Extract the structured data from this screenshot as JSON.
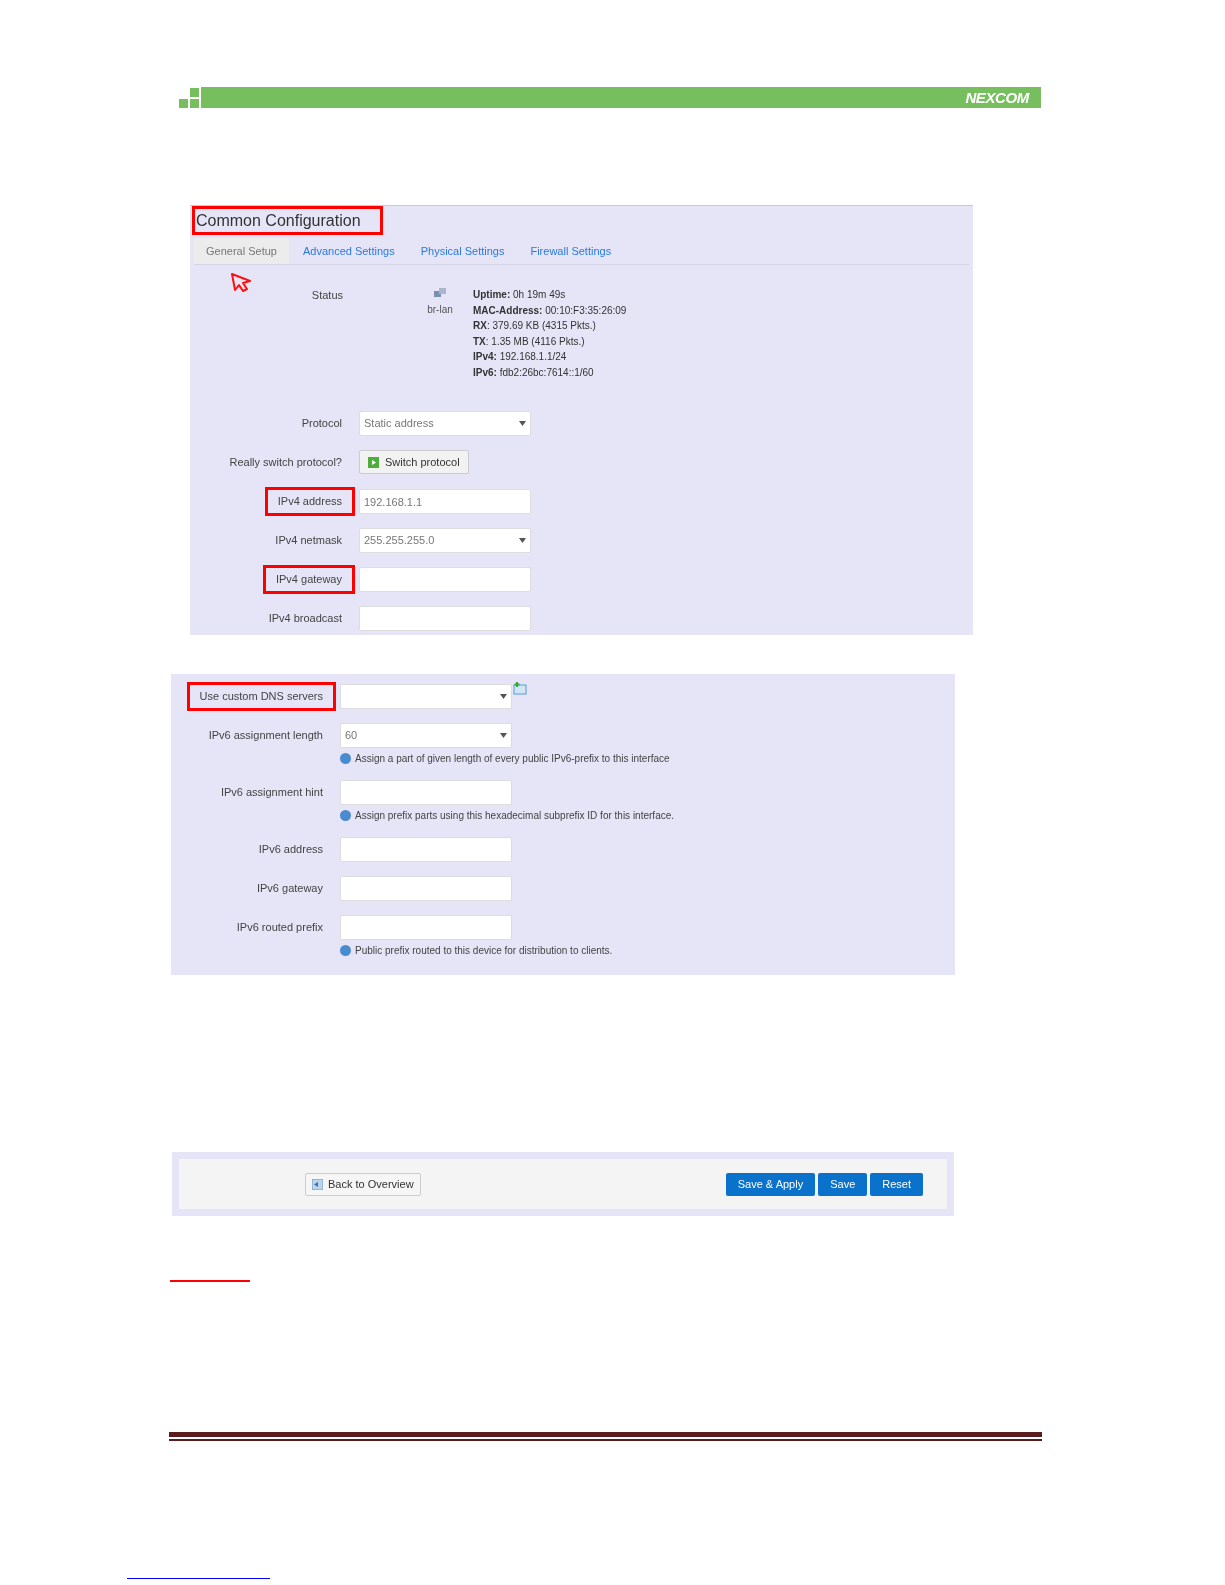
{
  "header": {
    "logo": "NEXCOM"
  },
  "common": {
    "title": "Common Configuration",
    "title_highlighted": true,
    "tabs": [
      {
        "label": "General Setup",
        "selected": true
      },
      {
        "label": "Advanced Settings",
        "selected": false
      },
      {
        "label": "Physical Settings",
        "selected": false
      },
      {
        "label": "Firewall Settings",
        "selected": false
      }
    ],
    "status": {
      "label": "Status",
      "interface": "br-lan",
      "lines": [
        "**Uptime:** 0h 19m 49s",
        "**MAC-Address:** 00:10:F3:35:26:09",
        "**RX**: 379.69 KB (4315 Pkts.)",
        "**TX**: 1.35 MB (4116 Pkts.)",
        "**IPv4:** 192.168.1.1/24",
        "**IPv6:** fdb2:26bc:7614::1/60"
      ]
    },
    "fields": [
      {
        "kind": "select",
        "label": "Protocol",
        "value": "Static address",
        "highlighted": false,
        "add": false
      },
      {
        "kind": "button",
        "label": "Really switch protocol?",
        "button": "Switch protocol",
        "highlighted": false,
        "add": false
      },
      {
        "kind": "text",
        "label": "IPv4 address",
        "value": "192.168.1.1",
        "highlighted": true,
        "add": false
      },
      {
        "kind": "select",
        "label": "IPv4 netmask",
        "value": "255.255.255.0",
        "highlighted": false,
        "add": false
      },
      {
        "kind": "text",
        "label": "IPv4 gateway",
        "highlighted": true,
        "add": false
      },
      {
        "kind": "text",
        "label": "IPv4 broadcast",
        "highlighted": false,
        "add": false
      }
    ]
  },
  "ipv6": {
    "fields": [
      {
        "kind": "select",
        "label": "Use custom DNS servers",
        "highlighted": true,
        "add": true
      },
      {
        "kind": "select",
        "label": "IPv6 assignment length",
        "value": "60",
        "hint": "Assign a part of given length of every public IPv6-prefix to this interface",
        "highlighted": false,
        "add": false
      },
      {
        "kind": "text",
        "label": "IPv6 assignment hint",
        "hint": "Assign prefix parts using this hexadecimal subprefix ID for this interface.",
        "highlighted": false,
        "add": false
      },
      {
        "kind": "text",
        "label": "IPv6 address",
        "highlighted": false,
        "add": false
      },
      {
        "kind": "text",
        "label": "IPv6 gateway",
        "highlighted": false,
        "add": false
      },
      {
        "kind": "text",
        "label": "IPv6 routed prefix",
        "hint": "Public prefix routed to this device for distribution to clients.",
        "highlighted": false,
        "add": false
      }
    ]
  },
  "actions": {
    "back": "Back to Overview",
    "buttons": [
      "Save & Apply",
      "Save",
      "Reset"
    ]
  }
}
